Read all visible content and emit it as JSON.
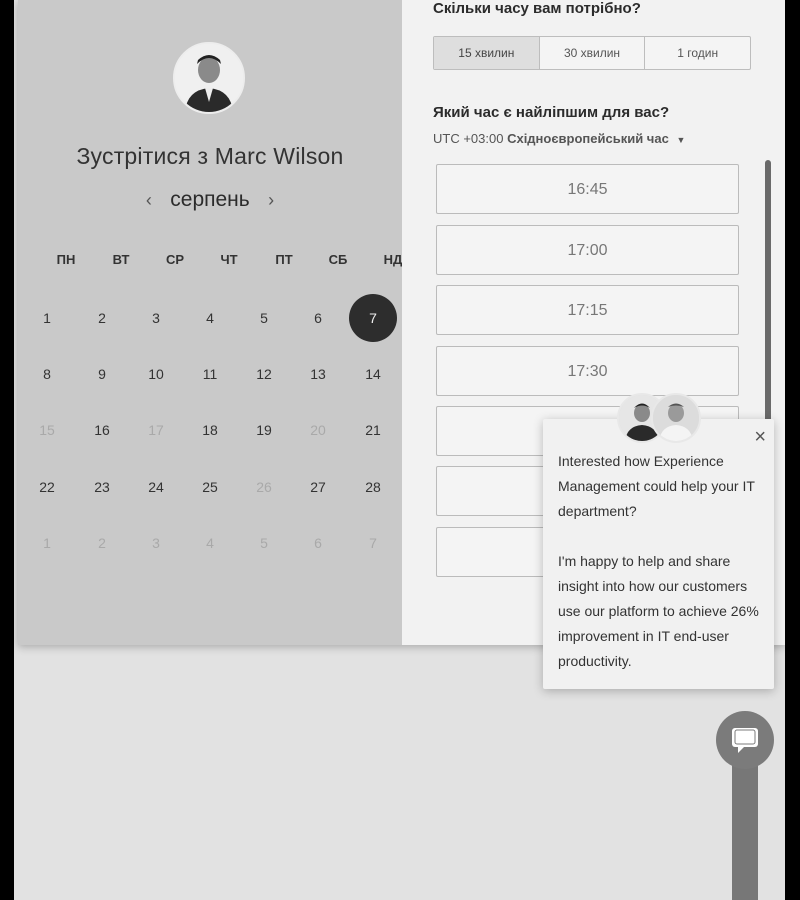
{
  "host": {
    "title": "Зустрітися з Marc Wilson",
    "avatar_icon": "person-photo-icon"
  },
  "calendar": {
    "month": "серпень",
    "prev_icon": "‹",
    "next_icon": "›",
    "weekdays": [
      "ПН",
      "ВТ",
      "СР",
      "ЧТ",
      "ПТ",
      "СБ",
      "НД"
    ],
    "weeks": [
      [
        {
          "d": "1",
          "s": "available"
        },
        {
          "d": "2",
          "s": "available"
        },
        {
          "d": "3",
          "s": "available"
        },
        {
          "d": "4",
          "s": "available"
        },
        {
          "d": "5",
          "s": "available"
        },
        {
          "d": "6",
          "s": "available"
        },
        {
          "d": "7",
          "s": "selected"
        }
      ],
      [
        {
          "d": "8",
          "s": "available"
        },
        {
          "d": "9",
          "s": "available"
        },
        {
          "d": "10",
          "s": "available"
        },
        {
          "d": "11",
          "s": "available"
        },
        {
          "d": "12",
          "s": "available"
        },
        {
          "d": "13",
          "s": "available"
        },
        {
          "d": "14",
          "s": "available"
        }
      ],
      [
        {
          "d": "15",
          "s": "muted"
        },
        {
          "d": "16",
          "s": "available"
        },
        {
          "d": "17",
          "s": "muted"
        },
        {
          "d": "18",
          "s": "available"
        },
        {
          "d": "19",
          "s": "available"
        },
        {
          "d": "20",
          "s": "muted"
        },
        {
          "d": "21",
          "s": "available"
        }
      ],
      [
        {
          "d": "22",
          "s": "available"
        },
        {
          "d": "23",
          "s": "available"
        },
        {
          "d": "24",
          "s": "available"
        },
        {
          "d": "25",
          "s": "available"
        },
        {
          "d": "26",
          "s": "muted"
        },
        {
          "d": "27",
          "s": "available"
        },
        {
          "d": "28",
          "s": "available"
        }
      ],
      [
        {
          "d": "1",
          "s": "muted"
        },
        {
          "d": "2",
          "s": "muted"
        },
        {
          "d": "3",
          "s": "muted"
        },
        {
          "d": "4",
          "s": "muted"
        },
        {
          "d": "5",
          "s": "muted"
        },
        {
          "d": "6",
          "s": "muted"
        },
        {
          "d": "7",
          "s": "muted"
        }
      ]
    ]
  },
  "duration": {
    "question": "Скільки часу вам потрібно?",
    "options": [
      "15 хвилин",
      "30 хвилин",
      "1 годин"
    ],
    "selected": "15 хвилин"
  },
  "time": {
    "question": "Який час є найліпшим для вас?",
    "tz_prefix": "UTC +03:00",
    "tz_name": "Східноєвропейський час",
    "slots": [
      "16:45",
      "17:00",
      "17:15",
      "17:30",
      "",
      "",
      ""
    ]
  },
  "popup": {
    "close_icon": "×",
    "paragraph1": "Interested how Experience Management could help your IT department?",
    "paragraph2": "I'm happy to help and share insight into how our customers use our platform to achieve 26% improvement in IT end-user productivity."
  },
  "colors": {
    "selected_day": "#2d2d2d",
    "left_panel": "#c9c9c9",
    "right_panel": "#f2f2f2"
  }
}
